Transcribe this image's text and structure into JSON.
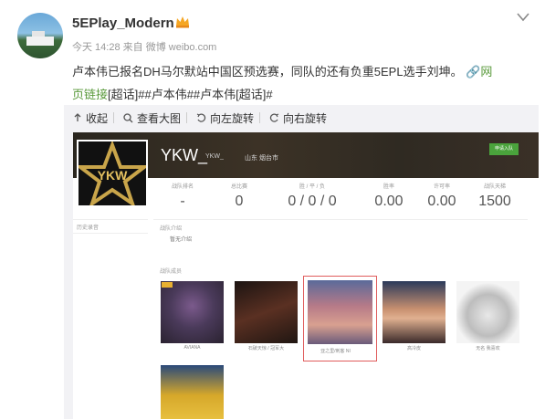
{
  "post": {
    "username": "5EPlay_Modern",
    "meta_time": "今天 14:28",
    "meta_from": "来自 微博 weibo.com",
    "text_main": "卢本伟已报名DH马尔默站中国区预选赛，同队的还有负重5EPL选手刘坤。",
    "link_icon_text": "网",
    "link_text_line2": "页链接",
    "tags": "[超话]##卢本伟##卢本伟[超话]#"
  },
  "toolbar": {
    "collapse_label": "收起",
    "view_large_label": "查看大图",
    "rotate_left_label": "向左旋转",
    "rotate_right_label": "向右旋转"
  },
  "team": {
    "name": "YKW_",
    "name_small": "YKW_",
    "location": "山东 烟台市",
    "join_label": "申请入队",
    "logo_text": "YKW",
    "stats": [
      {
        "label": "战队排名",
        "value": "-"
      },
      {
        "label": "总比赛",
        "value": "0"
      },
      {
        "label": "胜 / 平 / 负",
        "value": "0 / 0 / 0"
      },
      {
        "label": "胜率",
        "value": "0.00"
      },
      {
        "label": "许可率",
        "value": "0.00"
      },
      {
        "label": "战队天梯",
        "value": "1500"
      }
    ],
    "history_label": "历史录音",
    "intro_label": "战队介绍",
    "intro_value": "暂无介绍",
    "members_label": "战队成员",
    "members": [
      {
        "name": "AVIANA"
      },
      {
        "name": "石破天惊 / 冠军大"
      },
      {
        "name": "亚之里/刺客 NI"
      },
      {
        "name": "高冷皮"
      },
      {
        "name": "无名 我喜欢"
      }
    ]
  },
  "colors": {
    "link": "#eb7350",
    "join_button": "#4aa33c",
    "selected_border": "#e05c5c"
  }
}
